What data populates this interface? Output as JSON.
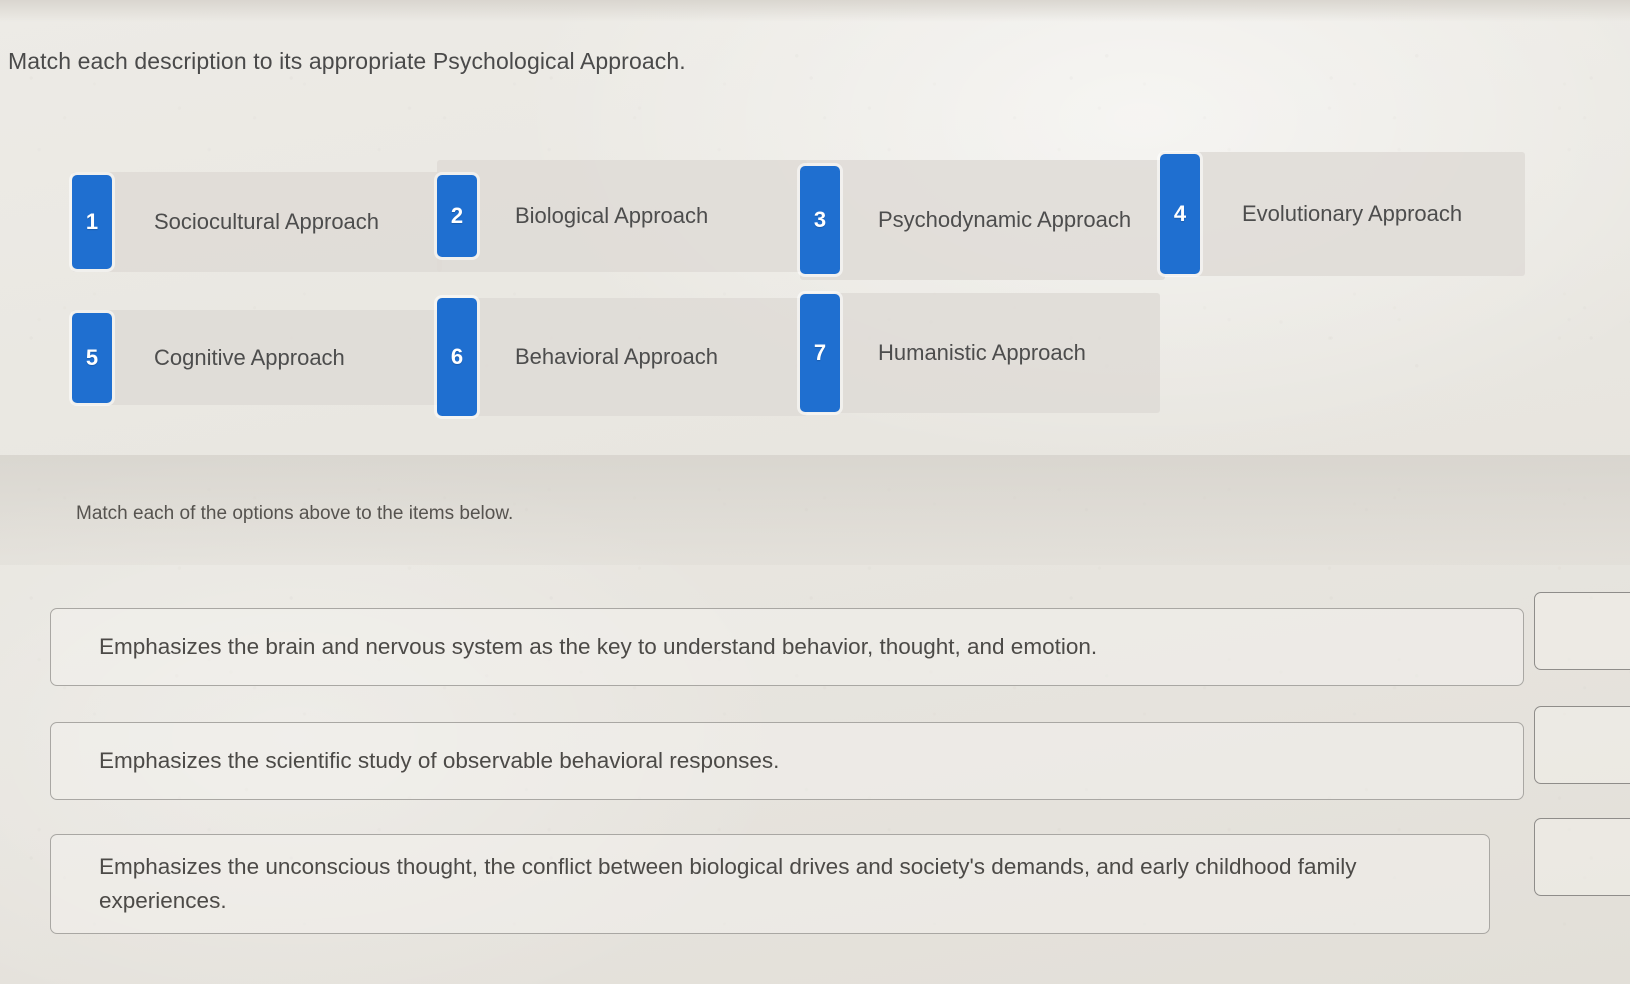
{
  "prompt": "Match each description to its appropriate Psychological Approach.",
  "sub_instruction": "Match each of the options above to the items below.",
  "colors": {
    "badge_blue": "#1f6fd0",
    "card_gray": "#dedbd5",
    "page_bg": "#eceae5",
    "text": "#4d4d4d"
  },
  "options": [
    {
      "number": "1",
      "label": "Sociocultural Approach"
    },
    {
      "number": "2",
      "label": "Biological Approach"
    },
    {
      "number": "3",
      "label": "Psychodynamic Approach"
    },
    {
      "number": "4",
      "label": "Evolutionary Approach"
    },
    {
      "number": "5",
      "label": "Cognitive Approach"
    },
    {
      "number": "6",
      "label": "Behavioral Approach"
    },
    {
      "number": "7",
      "label": "Humanistic Approach"
    }
  ],
  "match_items": [
    {
      "text": "Emphasizes the brain and nervous system as the key to understand behavior, thought, and emotion.",
      "selected": ""
    },
    {
      "text": "Emphasizes the scientific study of observable behavioral responses.",
      "selected": ""
    },
    {
      "text": "Emphasizes the unconscious thought, the conflict between biological drives and society's demands, and early childhood family experiences.",
      "selected": ""
    }
  ]
}
